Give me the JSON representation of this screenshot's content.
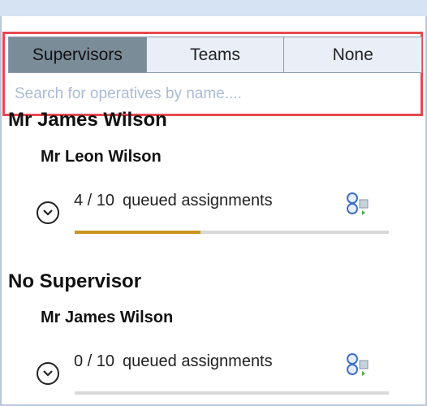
{
  "tabs": [
    {
      "label": "Supervisors",
      "active": true
    },
    {
      "label": "Teams",
      "active": false
    },
    {
      "label": "None",
      "active": false
    }
  ],
  "search": {
    "placeholder": "Search for operatives by name....",
    "value": ""
  },
  "groups": [
    {
      "title": "Mr James Wilson",
      "operatives": [
        {
          "name": "Mr Leon Wilson",
          "queued_count": "4 / 10",
          "queued_label": "queued assignments",
          "progress_fraction": 0.4
        }
      ]
    },
    {
      "title": "No Supervisor",
      "operatives": [
        {
          "name": "Mr James Wilson",
          "queued_count": "0 / 10",
          "queued_label": "queued assignments",
          "progress_fraction": 0.0
        }
      ]
    }
  ],
  "colors": {
    "highlight_border": "#e8494f",
    "active_tab": "#7b8c99",
    "progress_fill": "#c8951f"
  },
  "icons": {
    "expand": "chevron-down-icon",
    "assign": "reassign-operative-icon"
  }
}
